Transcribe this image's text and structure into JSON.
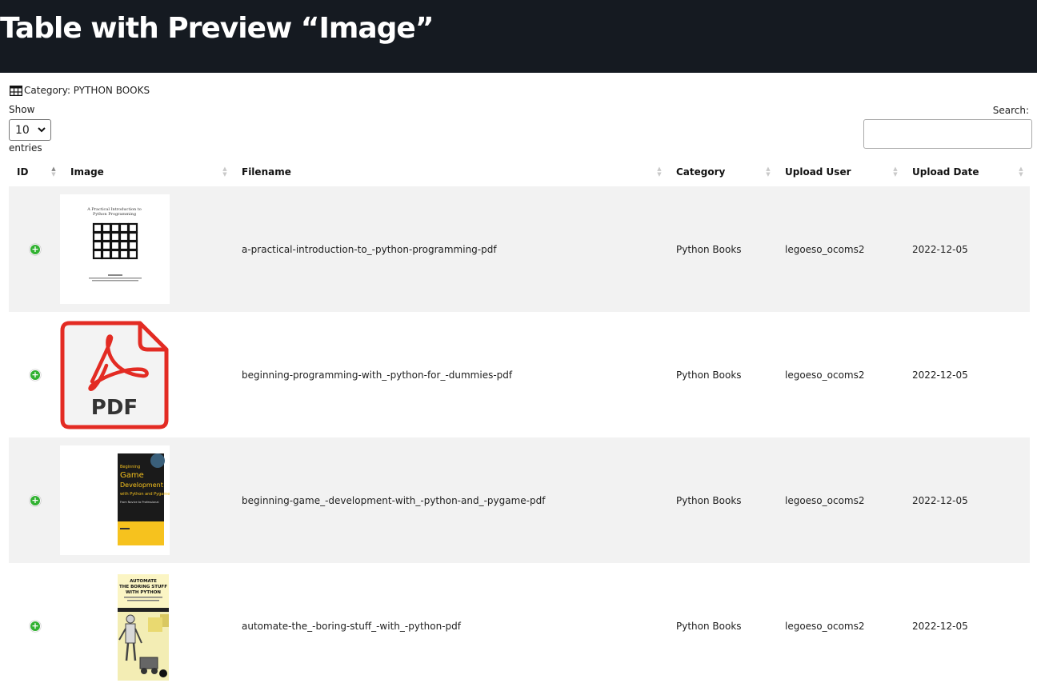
{
  "page": {
    "title": "Table with Preview “Image”"
  },
  "category_label": "Category: PYTHON BOOKS",
  "length_control": {
    "show_label": "Show",
    "selected": "10",
    "entries_label": "entries"
  },
  "search": {
    "label": "Search:",
    "value": ""
  },
  "table": {
    "columns": [
      "ID",
      "Image",
      "Filename",
      "Category",
      "Upload User",
      "Upload Date"
    ],
    "rows": [
      {
        "image": "book-cover-practical-intro",
        "cover_title": "A Practical Introduction to Python Programming",
        "filename": "a-practical-introduction-to_-python-programming-pdf",
        "category": "Python Books",
        "user": "legoeso_ocoms2",
        "date": "2022-12-05"
      },
      {
        "image": "pdf-file-icon",
        "cover_title": "PDF",
        "filename": "beginning-programming-with_-python-for_-dummies-pdf",
        "category": "Python Books",
        "user": "legoeso_ocoms2",
        "date": "2022-12-05"
      },
      {
        "image": "book-cover-game-development",
        "cover_title": "Beginning Game Development with Python and Pygame",
        "filename": "beginning-game_-development-with_-python-and_-pygame-pdf",
        "category": "Python Books",
        "user": "legoeso_ocoms2",
        "date": "2022-12-05"
      },
      {
        "image": "book-cover-automate-boring-stuff",
        "cover_title": "AUTOMATE THE BORING STUFF WITH PYTHON",
        "filename": "automate-the_-boring-stuff_-with_-python-pdf",
        "category": "Python Books",
        "user": "legoeso_ocoms2",
        "date": "2022-12-05"
      }
    ]
  },
  "colors": {
    "banner": "#151a21",
    "expand_button": "#31b131",
    "pdf_red": "#e32b23",
    "row_stripe": "#f2f2f2"
  }
}
